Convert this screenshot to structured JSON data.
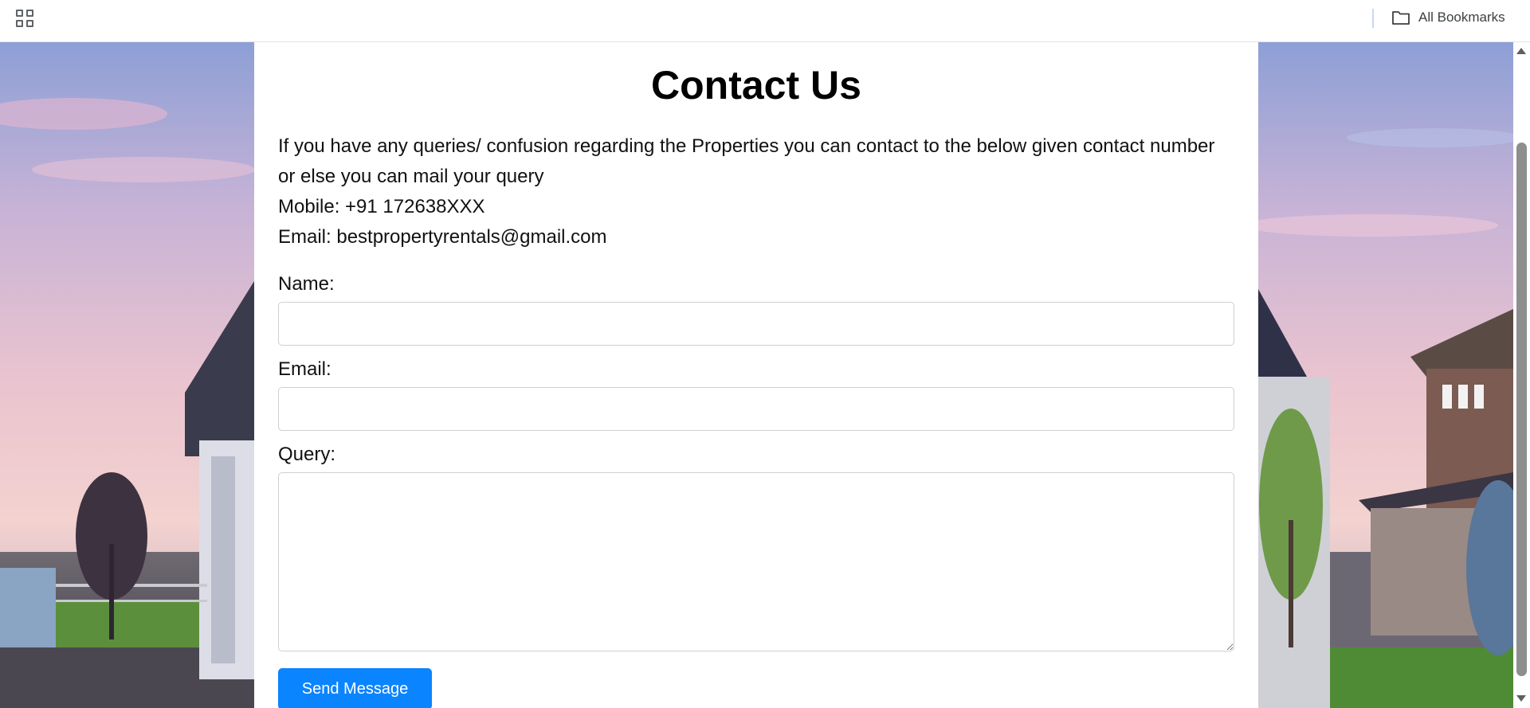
{
  "browser": {
    "apps_icon": "apps-grid-icon",
    "bookmarks_label": "All Bookmarks",
    "bookmarks_icon": "folder-icon"
  },
  "page": {
    "title": "Contact Us",
    "intro_line": "If you have any queries/ confusion regarding the Properties you can contact to the below given contact number or else you can mail your query",
    "mobile": "Mobile: +91 172638XXX",
    "email": "Email: bestpropertyrentals@gmail.com"
  },
  "form": {
    "name_label": "Name:",
    "name_value": "",
    "email_label": "Email:",
    "email_value": "",
    "query_label": "Query:",
    "query_value": "",
    "submit_label": "Send Message"
  },
  "colors": {
    "accent": "#0b84ff",
    "panel": "#ffffff"
  }
}
